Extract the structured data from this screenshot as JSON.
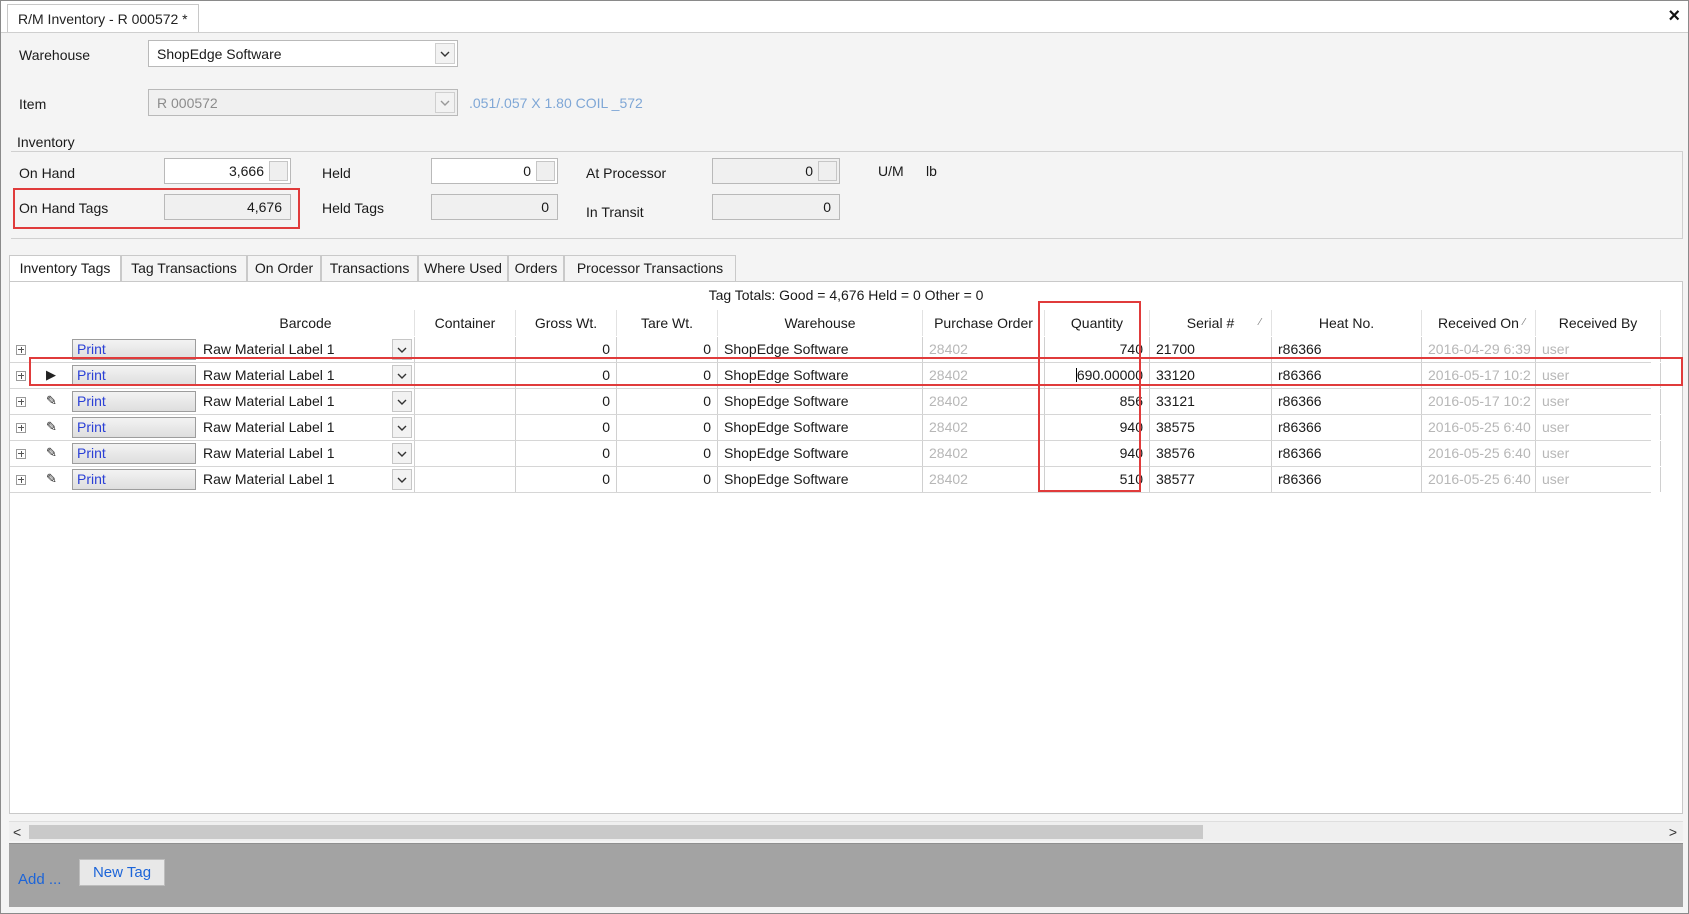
{
  "window": {
    "tab_title": "R/M Inventory - R 000572 *",
    "close_icon": "×"
  },
  "header": {
    "warehouse_label": "Warehouse",
    "warehouse_value": "ShopEdge Software",
    "item_label": "Item",
    "item_value": "R 000572",
    "item_description": ".051/.057 X 1.80  COIL  _572"
  },
  "inventory": {
    "group_title": "Inventory",
    "on_hand_label": "On Hand",
    "on_hand_value": "3,666",
    "held_label": "Held",
    "held_value": "0",
    "at_processor_label": "At Processor",
    "at_processor_value": "0",
    "um_label": "U/M",
    "um_value": "lb",
    "on_hand_tags_label": "On Hand Tags",
    "on_hand_tags_value": "4,676",
    "held_tags_label": "Held Tags",
    "held_tags_value": "0",
    "in_transit_label": "In Transit",
    "in_transit_value": "0"
  },
  "tabs": [
    {
      "label": "Inventory Tags",
      "active": true
    },
    {
      "label": "Tag Transactions"
    },
    {
      "label": "On Order"
    },
    {
      "label": "Transactions"
    },
    {
      "label": "Where Used"
    },
    {
      "label": "Orders"
    },
    {
      "label": "Processor Transactions"
    }
  ],
  "grid": {
    "totals": "Tag Totals:  Good = 4,676 Held = 0 Other = 0",
    "columns": [
      "Barcode",
      "Container",
      "Gross Wt.",
      "Tare Wt.",
      "Warehouse",
      "Purchase Order",
      "Quantity",
      "Serial #",
      "Heat No.",
      "Received On",
      "Received By"
    ],
    "rows": [
      {
        "print": "Print",
        "barcode": "Raw Material Label 1",
        "container": "",
        "gross": "0",
        "tare": "0",
        "warehouse": "ShopEdge Software",
        "po": "28402",
        "qty": "740",
        "serial": "21700",
        "heat": "r86366",
        "received_on": "2016-04-29 6:39",
        "received_by": "user",
        "indicator": ""
      },
      {
        "print": "Print",
        "barcode": "Raw Material Label 1",
        "container": "",
        "gross": "0",
        "tare": "0",
        "warehouse": "ShopEdge Software",
        "po": "28402",
        "qty": "690.00000",
        "serial": "33120",
        "heat": "r86366",
        "received_on": "2016-05-17 10:2",
        "received_by": "user",
        "indicator": "▶"
      },
      {
        "print": "Print",
        "barcode": "Raw Material Label 1",
        "container": "",
        "gross": "0",
        "tare": "0",
        "warehouse": "ShopEdge Software",
        "po": "28402",
        "qty": "856",
        "serial": "33121",
        "heat": "r86366",
        "received_on": "2016-05-17 10:2",
        "received_by": "user",
        "indicator": "✎"
      },
      {
        "print": "Print",
        "barcode": "Raw Material Label 1",
        "container": "",
        "gross": "0",
        "tare": "0",
        "warehouse": "ShopEdge Software",
        "po": "28402",
        "qty": "940",
        "serial": "38575",
        "heat": "r86366",
        "received_on": "2016-05-25 6:40",
        "received_by": "user",
        "indicator": "✎"
      },
      {
        "print": "Print",
        "barcode": "Raw Material Label 1",
        "container": "",
        "gross": "0",
        "tare": "0",
        "warehouse": "ShopEdge Software",
        "po": "28402",
        "qty": "940",
        "serial": "38576",
        "heat": "r86366",
        "received_on": "2016-05-25 6:40",
        "received_by": "user",
        "indicator": "✎"
      },
      {
        "print": "Print",
        "barcode": "Raw Material Label 1",
        "container": "",
        "gross": "0",
        "tare": "0",
        "warehouse": "ShopEdge Software",
        "po": "28402",
        "qty": "510",
        "serial": "38577",
        "heat": "r86366",
        "received_on": "2016-05-25 6:40",
        "received_by": "user",
        "indicator": "✎"
      }
    ]
  },
  "scrollbar": {
    "left_arrow": "<",
    "right_arrow": ">"
  },
  "footer": {
    "add_label": "Add ...",
    "new_tag_label": "New Tag"
  },
  "colors": {
    "highlight": "#e03b3b",
    "link": "#1c64d8",
    "print_text": "#2a3fd6",
    "footer_bg": "#a3a3a3"
  }
}
